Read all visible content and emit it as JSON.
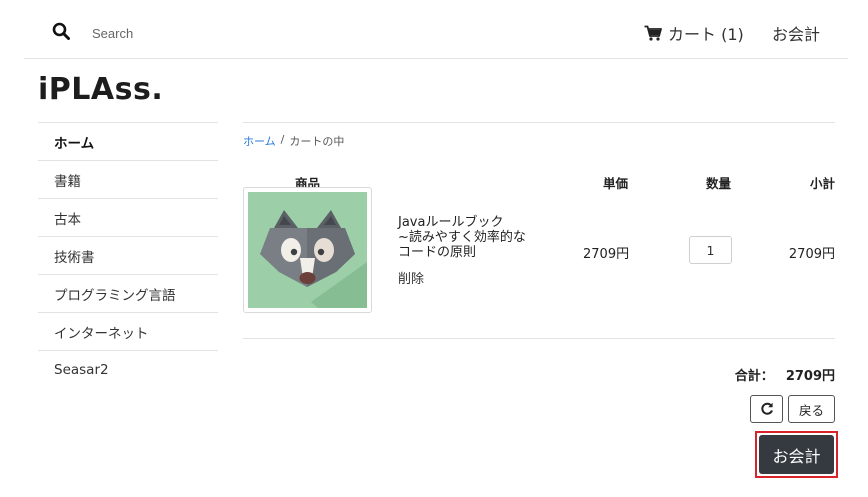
{
  "header": {
    "search_placeholder": "Search",
    "cart_label": "カート (1)",
    "checkout_label": "お会計"
  },
  "logo": "iPLAss.",
  "sidebar": {
    "items": [
      {
        "label": "ホーム",
        "active": true
      },
      {
        "label": "書籍"
      },
      {
        "label": "古本"
      },
      {
        "label": "技術書"
      },
      {
        "label": "プログラミング言語"
      },
      {
        "label": "インターネット"
      },
      {
        "label": "Seasar2"
      }
    ]
  },
  "breadcrumb": {
    "home": "ホーム",
    "separator": "/",
    "current": "カートの中"
  },
  "cart": {
    "columns": {
      "product": "商品",
      "unit_price": "単価",
      "quantity": "数量",
      "subtotal": "小計"
    },
    "items": [
      {
        "name_line1": "Javaルールブック",
        "name_line2": "~読みやすく効率的な",
        "name_line3": "コードの原則",
        "delete_label": "削除",
        "unit_price": "2709円",
        "quantity": "1",
        "subtotal": "2709円"
      }
    ],
    "total_label": "合計：",
    "total_value": "2709円",
    "back_label": "戻る",
    "checkout_label": "お会計"
  },
  "icons": {
    "search": "search-icon",
    "cart": "cart-icon",
    "reload": "reload-icon",
    "product_image": "wolf-illustration"
  },
  "colors": {
    "link": "#2a7ae2",
    "checkout_button": "#343a40",
    "highlight": "#d9232b",
    "image_background": "#9ccfa7"
  }
}
